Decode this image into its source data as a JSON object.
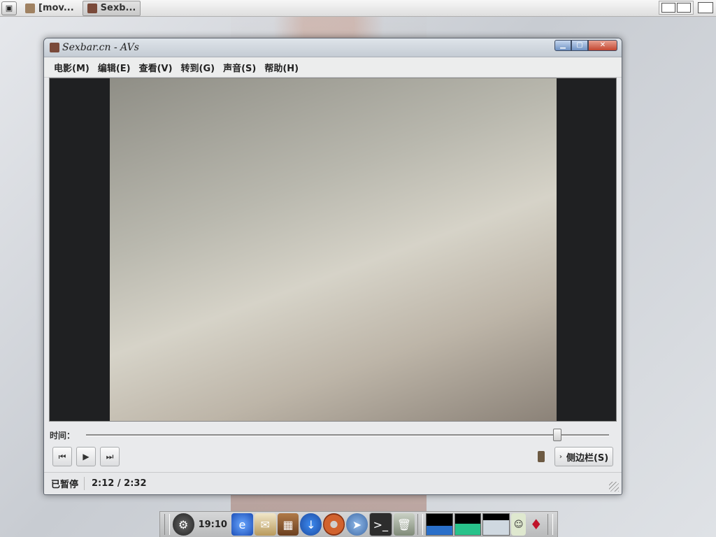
{
  "top_bar": {
    "tasks": [
      {
        "label": "[mov...",
        "active": false
      },
      {
        "label": "Sexb...",
        "active": true
      }
    ]
  },
  "window": {
    "title": "Sexbar.cn - AVs",
    "menu": [
      {
        "label": "电影(M)"
      },
      {
        "label": "编辑(E)"
      },
      {
        "label": "查看(V)"
      },
      {
        "label": "转到(G)"
      },
      {
        "label": "声音(S)"
      },
      {
        "label": "帮助(H)"
      }
    ],
    "seek": {
      "label": "时间：",
      "position": 0.9
    },
    "controls": {
      "prev_icon": "skip-back-icon",
      "play_icon": "play-icon",
      "next_icon": "skip-forward-icon",
      "sidebar_label": "侧边栏(S)"
    },
    "status": {
      "state": "已暂停",
      "time": "2:12 / 2:32"
    }
  },
  "dock": {
    "clock": "19:10",
    "launchers": [
      "gnome-icon",
      "browser-icon",
      "mail-clock-icon",
      "chest-icon",
      "download-icon",
      "donut-icon",
      "compass-icon",
      "terminal-icon",
      "trash-icon"
    ],
    "graph_levels": [
      0.45,
      0.55,
      0.7
    ],
    "tray_icons": [
      "face-icon",
      "ruby-icon"
    ]
  },
  "colors": {
    "accent": "#6f92c3",
    "close": "#c34630",
    "graph_cpu": "#2a6fc9",
    "graph_mem": "#28c28a",
    "graph_net": "#cfd8e0"
  }
}
